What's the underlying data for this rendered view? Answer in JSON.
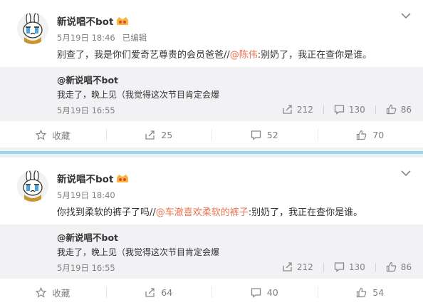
{
  "posts": [
    {
      "author": "新说唱不bot",
      "vip_badge": "crown-eyes-icon",
      "timestamp": "5月19日 18:46",
      "edited": "已编辑",
      "text_main": "别查了，我是你们爱奇艺尊贵的会员爸爸//",
      "mention": "@陈伟",
      "text_rest": ":别奶了，我正在查你是谁。",
      "quote": {
        "author": "@新说唱不bot",
        "text": "我走了，晚上见（我觉得这次节目肯定会爆",
        "timestamp": "5月19日 16:55",
        "reposts": "212",
        "comments": "130",
        "likes": "86"
      },
      "actions": {
        "favorite": "收藏",
        "repost": "25",
        "comment": "52",
        "like": "70"
      }
    },
    {
      "author": "新说唱不bot",
      "vip_badge": "crown-eyes-icon",
      "timestamp": "5月19日 18:40",
      "edited": "",
      "text_main": "你找到柔软的裤子了吗//",
      "mention": "@车澈喜欢柔软的裤子",
      "text_rest": ":别奶了，我正在查你是谁。",
      "quote": {
        "author": "@新说唱不bot",
        "text": "我走了，晚上见（我觉得这次节目肯定会爆",
        "timestamp": "5月19日 16:55",
        "reposts": "212",
        "comments": "130",
        "likes": "86"
      },
      "actions": {
        "favorite": "收藏",
        "repost": "64",
        "comment": "40",
        "like": "54"
      }
    }
  ],
  "colors": {
    "link": "#eb7350",
    "separator": "#9fd6e3",
    "quote_bg": "#f2f2f5",
    "muted": "#808080"
  }
}
